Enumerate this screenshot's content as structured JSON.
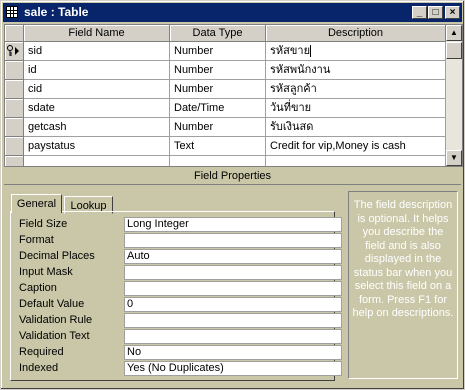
{
  "window": {
    "title": "sale : Table",
    "minimize": "_",
    "maximize": "□",
    "close": "×"
  },
  "grid": {
    "headers": [
      "Field Name",
      "Data Type",
      "Description"
    ],
    "rows": [
      {
        "field": "sid",
        "type": "Number",
        "desc": "รหัสขาย",
        "selected": true
      },
      {
        "field": "id",
        "type": "Number",
        "desc": "รหัสพนักงาน"
      },
      {
        "field": "cid",
        "type": "Number",
        "desc": "รหัสลูกค้า"
      },
      {
        "field": "sdate",
        "type": "Date/Time",
        "desc": "วันที่ขาย"
      },
      {
        "field": "getcash",
        "type": "Number",
        "desc": "รับเงินสด"
      },
      {
        "field": "paystatus",
        "type": "Text",
        "desc": "Credit for vip,Money is cash"
      }
    ]
  },
  "field_properties": {
    "title": "Field Properties",
    "tabs": [
      "General",
      "Lookup"
    ],
    "properties": [
      {
        "label": "Field Size",
        "value": "Long Integer"
      },
      {
        "label": "Format",
        "value": ""
      },
      {
        "label": "Decimal Places",
        "value": "Auto"
      },
      {
        "label": "Input Mask",
        "value": ""
      },
      {
        "label": "Caption",
        "value": ""
      },
      {
        "label": "Default Value",
        "value": "0"
      },
      {
        "label": "Validation Rule",
        "value": ""
      },
      {
        "label": "Validation Text",
        "value": ""
      },
      {
        "label": "Required",
        "value": "No"
      },
      {
        "label": "Indexed",
        "value": "Yes (No Duplicates)"
      }
    ],
    "help_text": "The field description is optional.  It helps you describe the field and is also displayed in the status bar when you select this field on a form.  Press F1 for help on descriptions."
  },
  "colors": {
    "titlebar": "#08246b",
    "panel": "#c9c7a8"
  }
}
